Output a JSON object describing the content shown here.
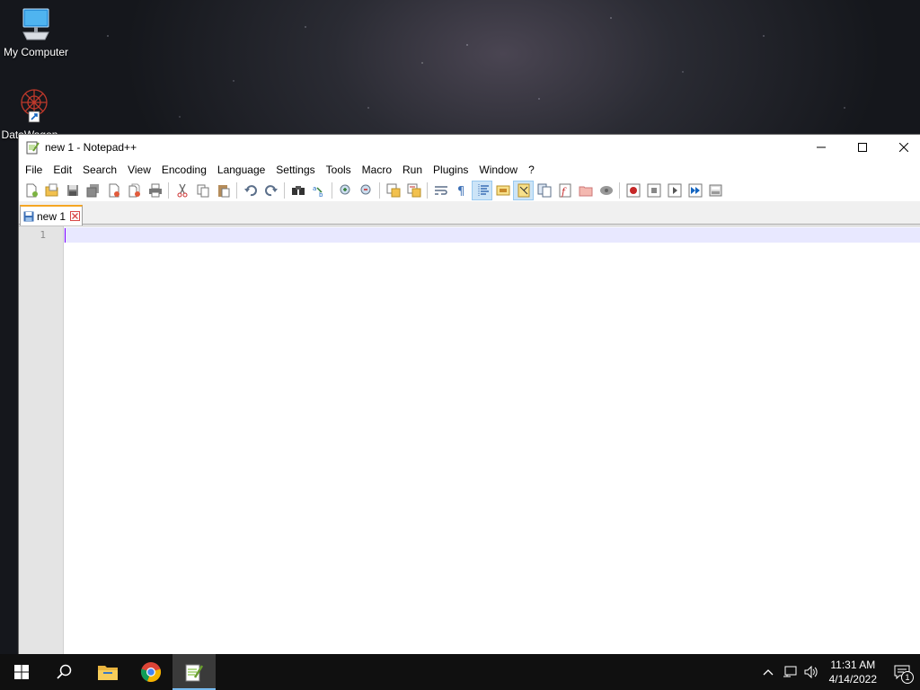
{
  "desktop": {
    "icons": [
      {
        "label": "My Computer",
        "icon": "monitor-icon"
      },
      {
        "label": "DataWagon...",
        "icon": "datawagon-icon"
      }
    ]
  },
  "window": {
    "title": "new 1 - Notepad++",
    "menu": [
      "File",
      "Edit",
      "Search",
      "View",
      "Encoding",
      "Language",
      "Settings",
      "Tools",
      "Macro",
      "Run",
      "Plugins",
      "Window",
      "?"
    ],
    "toolbar_icons": [
      "new-file-icon",
      "open-file-icon",
      "save-icon",
      "save-all-icon",
      "close-icon",
      "close-all-icon",
      "print-icon",
      "cut-icon",
      "copy-icon",
      "paste-icon",
      "undo-icon",
      "redo-icon",
      "find-icon",
      "replace-icon",
      "zoom-in-icon",
      "zoom-out-icon",
      "sync-vertical-icon",
      "sync-horizontal-icon",
      "word-wrap-icon",
      "show-all-chars-icon",
      "indent-guide-icon",
      "language-icon",
      "doc-map-icon",
      "doc-list-icon",
      "function-list-icon",
      "folder-workspace-icon",
      "monitoring-icon",
      "record-macro-icon",
      "stop-record-icon",
      "play-macro-icon",
      "run-macro-multiple-icon",
      "save-macro-icon"
    ],
    "tab": {
      "label": "new 1"
    },
    "editor": {
      "line_number": "1",
      "content": ""
    }
  },
  "taskbar": {
    "apps": [
      "start-icon",
      "search-icon",
      "file-explorer-icon",
      "chrome-icon",
      "notepadpp-icon"
    ],
    "clock": {
      "time": "11:31 AM",
      "date": "4/14/2022"
    },
    "notification_count": "1"
  },
  "colors": {
    "accent_tab": "#f5a623",
    "current_line": "#e8e8ff",
    "caret": "#8000ff",
    "taskbar": "#101010"
  }
}
